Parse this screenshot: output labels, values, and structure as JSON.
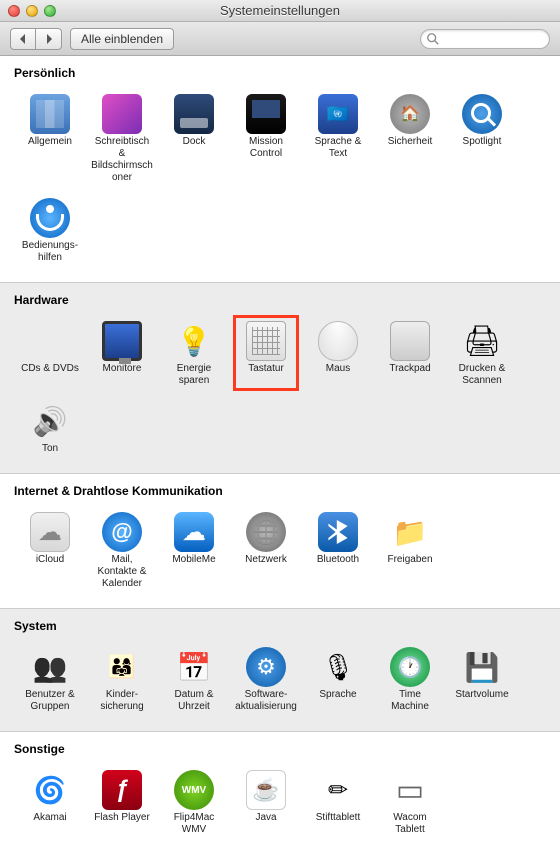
{
  "window": {
    "title": "Systemeinstellungen"
  },
  "toolbar": {
    "show_all": "Alle einblenden",
    "search_placeholder": ""
  },
  "sections": {
    "personal": {
      "title": "Persönlich",
      "items": [
        {
          "name": "general",
          "label": "Allgemein",
          "icon": "ic-general"
        },
        {
          "name": "desktop",
          "label": "Schreibtisch & Bildschirmschoner",
          "icon": "ic-desktop"
        },
        {
          "name": "dock",
          "label": "Dock",
          "icon": "ic-dock"
        },
        {
          "name": "mission-control",
          "label": "Mission Control",
          "icon": "ic-mission"
        },
        {
          "name": "language",
          "label": "Sprache & Text",
          "icon": "ic-lang"
        },
        {
          "name": "security",
          "label": "Sicherheit",
          "icon": "ic-security"
        },
        {
          "name": "spotlight",
          "label": "Spotlight",
          "icon": "ic-spotlight"
        },
        {
          "name": "accessibility",
          "label": "Bedienungs-hilfen",
          "icon": "ic-access"
        }
      ]
    },
    "hardware": {
      "title": "Hardware",
      "items": [
        {
          "name": "cds-dvds",
          "label": "CDs & DVDs",
          "icon": "ic-cd"
        },
        {
          "name": "displays",
          "label": "Monitore",
          "icon": "ic-display"
        },
        {
          "name": "energy",
          "label": "Energie sparen",
          "icon": "ic-energy"
        },
        {
          "name": "keyboard",
          "label": "Tastatur",
          "icon": "ic-keyboard",
          "highlight": true
        },
        {
          "name": "mouse",
          "label": "Maus",
          "icon": "ic-mouse"
        },
        {
          "name": "trackpad",
          "label": "Trackpad",
          "icon": "ic-trackpad"
        },
        {
          "name": "print",
          "label": "Drucken & Scannen",
          "icon": "ic-print"
        },
        {
          "name": "sound",
          "label": "Ton",
          "icon": "ic-sound"
        }
      ]
    },
    "internet": {
      "title": "Internet & Drahtlose Kommunikation",
      "items": [
        {
          "name": "icloud",
          "label": "iCloud",
          "icon": "ic-icloud"
        },
        {
          "name": "mail",
          "label": "Mail, Kontakte & Kalender",
          "icon": "ic-mail"
        },
        {
          "name": "mobileme",
          "label": "MobileMe",
          "icon": "ic-mobileme"
        },
        {
          "name": "network",
          "label": "Netzwerk",
          "icon": "ic-network"
        },
        {
          "name": "bluetooth",
          "label": "Bluetooth",
          "icon": "ic-bluetooth"
        },
        {
          "name": "sharing",
          "label": "Freigaben",
          "icon": "ic-share"
        }
      ]
    },
    "system": {
      "title": "System",
      "items": [
        {
          "name": "users",
          "label": "Benutzer & Gruppen",
          "icon": "ic-users"
        },
        {
          "name": "parental",
          "label": "Kinder-sicherung",
          "icon": "ic-parental"
        },
        {
          "name": "datetime",
          "label": "Datum & Uhrzeit",
          "icon": "ic-date"
        },
        {
          "name": "swupdate",
          "label": "Software-aktualisierung",
          "icon": "ic-swupdate"
        },
        {
          "name": "speech",
          "label": "Sprache",
          "icon": "ic-speech"
        },
        {
          "name": "timemachine",
          "label": "Time Machine",
          "icon": "ic-tm"
        },
        {
          "name": "startup",
          "label": "Startvolume",
          "icon": "ic-startup"
        }
      ]
    },
    "other": {
      "title": "Sonstige",
      "items": [
        {
          "name": "akamai",
          "label": "Akamai",
          "icon": "ic-akamai"
        },
        {
          "name": "flash",
          "label": "Flash Player",
          "icon": "ic-flash"
        },
        {
          "name": "flip4mac",
          "label": "Flip4Mac WMV",
          "icon": "ic-flip4mac"
        },
        {
          "name": "java",
          "label": "Java",
          "icon": "ic-java"
        },
        {
          "name": "stylus",
          "label": "Stifttablett",
          "icon": "ic-stylus"
        },
        {
          "name": "wacom",
          "label": "Wacom Tablett",
          "icon": "ic-wacom"
        }
      ]
    }
  }
}
